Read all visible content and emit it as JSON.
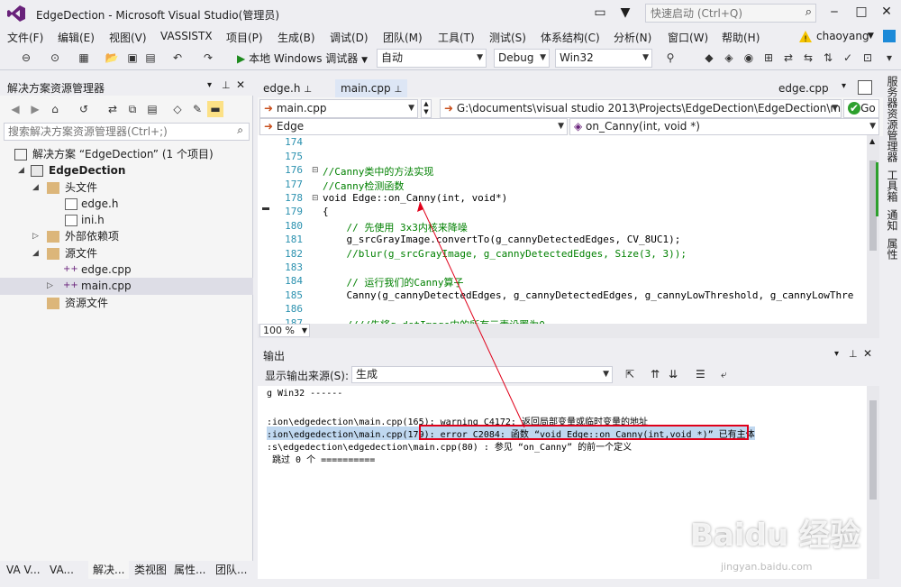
{
  "window": {
    "title": "EdgeDection - Microsoft Visual Studio(管理员)",
    "quick_launch_placeholder": "快速启动 (Ctrl+Q)"
  },
  "menu": [
    "文件(F)",
    "编辑(E)",
    "视图(V)",
    "VASSISTX",
    "项目(P)",
    "生成(B)",
    "调试(D)",
    "团队(M)",
    "工具(T)",
    "测试(S)",
    "体系结构(C)",
    "分析(N)",
    "窗口(W)",
    "帮助(H)"
  ],
  "user": "chaoyang",
  "toolbar": {
    "run_label": "本地 Windows 调试器",
    "config_auto": "自动",
    "config": "Debug",
    "platform": "Win32"
  },
  "solution_explorer": {
    "title": "解决方案资源管理器",
    "search_placeholder": "搜索解决方案资源管理器(Ctrl+;)",
    "items": [
      {
        "label": "解决方案 “EdgeDection” (1 个项目)"
      },
      {
        "label": "EdgeDection"
      },
      {
        "label": "头文件"
      },
      {
        "label": "edge.h"
      },
      {
        "label": "ini.h"
      },
      {
        "label": "外部依赖项"
      },
      {
        "label": "源文件"
      },
      {
        "label": "edge.cpp"
      },
      {
        "label": "main.cpp"
      },
      {
        "label": "资源文件"
      }
    ]
  },
  "bottom_tabs": [
    "VA V...",
    "VA...",
    "解决...",
    "类视图",
    "属性...",
    "团队..."
  ],
  "editor": {
    "tabs": [
      "edge.h",
      "main.cpp",
      "edge.cpp"
    ],
    "file_combo": "main.cpp",
    "path_combo": "G:\\documents\\visual studio 2013\\Projects\\EdgeDection\\EdgeDection\\ma",
    "go_label": "Go",
    "class_combo": "Edge",
    "member_combo": "on_Canny(int, void *)",
    "zoom": "100 %",
    "line_numbers": [
      "174",
      "175",
      "176",
      "177",
      "178",
      "179",
      "180",
      "181",
      "182",
      "183",
      "184",
      "185",
      "186",
      "187"
    ],
    "lines": [
      "",
      "",
      "//Canny类中的方法实现",
      "//Canny检测函数",
      "void Edge::on_Canny(int, void*)",
      "{",
      "    // 先使用 3x3内核来降噪",
      "    g_srcGrayImage.convertTo(g_cannyDetectedEdges, CV_8UC1);",
      "    //blur(g_srcGrayImage, g_cannyDetectedEdges, Size(3, 3));",
      "",
      "    // 运行我们的Canny算子",
      "    Canny(g_cannyDetectedEdges, g_cannyDetectedEdges, g_cannyLowThreshold, g_cannyLowThre",
      "",
      "    ////先将g_dstImage内的所有元素设置为0"
    ]
  },
  "output": {
    "title": "输出",
    "source_label": "显示输出来源(S):",
    "source_value": "生成",
    "lines": [
      "g Win32 ------",
      "",
      ":ion\\edgedection\\main.cpp(165): warning C4172: 返回局部变量或临时变量的地址",
      ":ion\\edgedection\\main.cpp(179): error C2084: 函数 “void Edge::on_Canny(int,void *)” 已有主体",
      ":s\\edgedection\\edgedection\\main.cpp(80) : 参见 “on_Canny” 的前一个定义",
      " 跳过 0 个 =========="
    ]
  },
  "right_tabs": [
    "服务器资源管理器",
    "工具箱",
    "通知",
    "属性"
  ],
  "watermark": {
    "brand": "Baidu 经验",
    "url": "jingyan.baidu.com"
  },
  "colors": {
    "accent": "#68217a",
    "error_box": "#e0001a",
    "comment": "#008000",
    "keyword": "#0000ff"
  }
}
